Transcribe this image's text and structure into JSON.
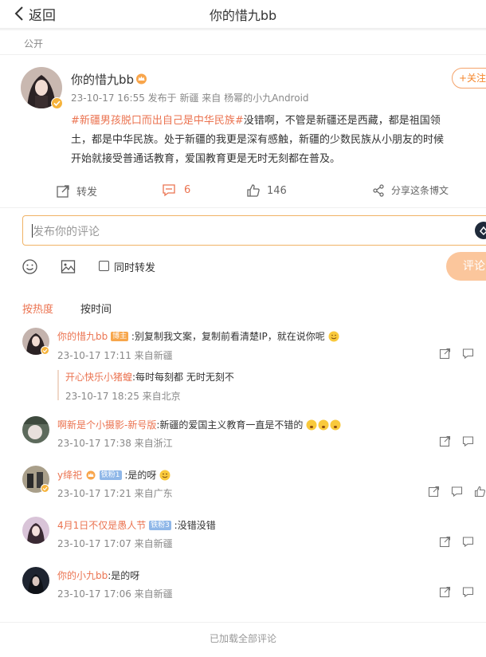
{
  "header": {
    "back_label": "返回",
    "title": "你的惜九bb"
  },
  "post": {
    "visibility": "公开",
    "author": "你的惜九bb",
    "follow_label": "+关注",
    "meta": "23-10-17 16:55  发布于 新疆  来自 杨幂的小九Android",
    "hashtag": "#新疆男孩脱口而出自己是中华民族#",
    "body_line1": "没错啊，不管是新疆还是西藏，都是祖国领",
    "body_line2": "土，都是中华民族。处于新疆的我更是深有感触，新疆的少数民族从小朋友的时候",
    "body_line3": "开始就接受普通话教育，爱国教育更是无时无刻都在普及。",
    "actions": {
      "repost": "转发",
      "comment_count": "6",
      "like_count": "146",
      "share": "分享这条博文"
    }
  },
  "composer": {
    "placeholder": "发布你的评论",
    "repost_label": "同时转发",
    "submit": "评论"
  },
  "sort": {
    "hot": "按热度",
    "time": "按时间"
  },
  "comments": [
    {
      "user": "你的惜九bb",
      "badge": "博主",
      "text": ":别复制我文案，复制前看清楚IP，就在说你呢",
      "meta": "23-10-17 17:11  来自新疆",
      "reply": {
        "user": "开心快乐小猪蝗",
        "text": ":每时每刻都 无时无刻不",
        "meta": "23-10-17 18:25  来自北京"
      }
    },
    {
      "user": "啊新是个小摄影-新号版",
      "text": ":新疆的爱国主义教育一直是不错的",
      "meta": "23-10-17 17:38  来自浙江"
    },
    {
      "user": "y绛祀",
      "badge": "铁粉1",
      "text": ":是的呀",
      "meta": "23-10-17 17:21  来自广东"
    },
    {
      "user": "4月1日不仅是愚人节",
      "badge": "铁粉3",
      "text": ":没错没错",
      "meta": "23-10-17 17:07  来自新疆"
    },
    {
      "user": "你的小九bb",
      "text": ":是的呀",
      "meta": "23-10-17 17:06  来自新疆"
    }
  ],
  "footer": "已加载全部评论"
}
